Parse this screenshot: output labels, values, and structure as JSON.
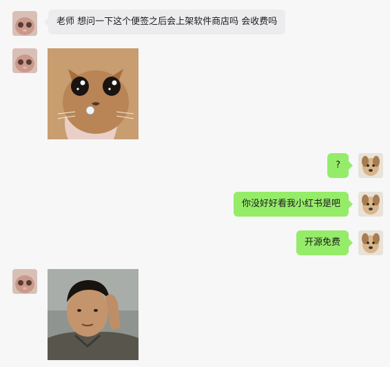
{
  "messages": [
    {
      "side": "left",
      "type": "text",
      "text": "老师 想问一下这个便签之后会上架软件商店吗 会收费吗"
    },
    {
      "side": "left",
      "type": "image",
      "image": "crying-cat-sticker"
    },
    {
      "side": "right",
      "type": "text",
      "text": "?"
    },
    {
      "side": "right",
      "type": "text",
      "text": "你没好好看我小红书是吧"
    },
    {
      "side": "right",
      "type": "text",
      "text": "开源免费"
    },
    {
      "side": "left",
      "type": "image",
      "image": "man-scratching-head-sticker"
    }
  ],
  "avatars": {
    "left": "cat-avatar",
    "right": "dog-avatar"
  },
  "colors": {
    "background": "#f7f7f8",
    "incoming_bubble": "#ececee",
    "outgoing_bubble": "#95ec69"
  }
}
